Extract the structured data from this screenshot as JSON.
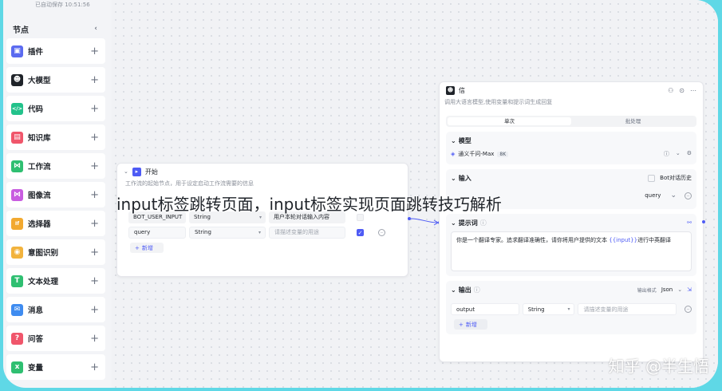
{
  "topbar": {
    "text": "已自动保存 10:51:56"
  },
  "sidebar": {
    "title": "节点",
    "collapse_icon": "chevron-left-icon",
    "items": [
      {
        "label": "插件",
        "icon": "cube-icon",
        "color": "#5b6bf0"
      },
      {
        "label": "大模型",
        "icon": "robot-icon",
        "color": "#1f2329"
      },
      {
        "label": "代码",
        "icon": "code-icon",
        "color": "#23c28b"
      },
      {
        "label": "知识库",
        "icon": "book-icon",
        "color": "#f0566b"
      },
      {
        "label": "工作流",
        "icon": "flow-icon",
        "color": "#2fbf71"
      },
      {
        "label": "图像流",
        "icon": "image-flow-icon",
        "color": "#c85ce0"
      },
      {
        "label": "选择器",
        "icon": "if-icon",
        "color": "#f2a930"
      },
      {
        "label": "意图识别",
        "icon": "intent-icon",
        "color": "#f2b33d"
      },
      {
        "label": "文本处理",
        "icon": "text-icon",
        "color": "#2fbf71"
      },
      {
        "label": "消息",
        "icon": "message-icon",
        "color": "#3f8cf0"
      },
      {
        "label": "问答",
        "icon": "qa-icon",
        "color": "#f0566b"
      },
      {
        "label": "变量",
        "icon": "variable-icon",
        "color": "#2fbf71"
      }
    ]
  },
  "start_node": {
    "title": "开始",
    "description": "工作流的起始节点，用于设定启动工作流需要的信息",
    "rows": [
      {
        "name": "BOT_USER_INPUT",
        "type": "String",
        "desc": "用户本轮对话输入内容",
        "checked": false
      },
      {
        "name": "query",
        "type": "String",
        "desc": "请描述变量的用途",
        "checked": true
      }
    ],
    "add_label": "新增"
  },
  "llm_node": {
    "title": "信",
    "description": "调用大语言模型,使用变量和提示词生成回复",
    "tabs": [
      "单次",
      "批处理"
    ],
    "model_section": {
      "title": "模型",
      "model_name": "通义千问-Max",
      "tag": "8K"
    },
    "input_section": {
      "title": "输入",
      "history_label": "Bot对话历史",
      "value_partial": "query"
    },
    "prompt_section": {
      "title": "提示词",
      "text_before": "你是一个翻译专家。追求翻译准确性，请你将用户提供的文本 ",
      "variable": "{{input}}",
      "text_after": "进行中英翻译"
    },
    "output_section": {
      "title": "输出",
      "format_label": "输出格式",
      "format_value": "Json",
      "row": {
        "name": "output",
        "type": "String",
        "desc": "请描述变量的用途"
      },
      "add_label": "新增"
    }
  },
  "overlay_title": "input标签跳转页面，input标签实现页面跳转技巧解析",
  "watermark": "知乎 @半生悟"
}
